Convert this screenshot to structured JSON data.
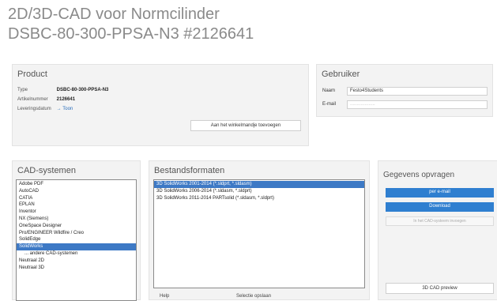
{
  "header": {
    "title_line1": "2D/3D-CAD voor Normcilinder",
    "title_line2": "DSBC-80-300-PPSA-N3 #2126641"
  },
  "product": {
    "heading": "Product",
    "type_label": "Type",
    "type_value": "DSBC-80-300-PPSA-N3",
    "article_label": "Artikelnummer",
    "article_value": "2126641",
    "delivery_label": "Leveringsdatum",
    "delivery_value": "→ Toon",
    "add_button": "Aan het winkelmandje toevoegen"
  },
  "user": {
    "heading": "Gebruiker",
    "name_label": "Naam",
    "name_value": "Festo4Students",
    "email_label": "E-mail",
    "email_placeholder": "..................."
  },
  "cad_systems": {
    "heading": "CAD-systemen",
    "items": [
      "Adobe PDF",
      "AutoCAD",
      "CATIA",
      "EPLAN",
      "Inventor",
      "NX (Siemens)",
      "OneSpace Designer",
      "Pro/ENGINEER Wildfire / Creo",
      "SolidEdge",
      "SolidWorks",
      "... andere CAD-systemen",
      "Neutraal 2D",
      "Neutraal 3D"
    ],
    "selected_index": 9
  },
  "file_formats": {
    "heading": "Bestandsformaten",
    "items": [
      "3D SolidWorks 2001-2014 (*.sldprt, *.sldasm)",
      "3D SolidWorks 2006-2014 (*.sldasm, *.sldprt)",
      "3D SolidWorks 2011-2014 PARTsolid (*.sldasm, *.sldprt)"
    ],
    "selected_index": 0,
    "help_label": "Help",
    "reset_label": "Selectie opslaan"
  },
  "request": {
    "heading": "Gegevens opvragen",
    "email_button": "per e-mail",
    "download_button": "Download",
    "add_cad_button": "In het CAD-systeem invoegen",
    "preview_button": "3D CAD preview"
  },
  "colors": {
    "accent": "#2f7fd0",
    "selection": "#3d79c5",
    "panel_bg": "#f3f3f3",
    "title_grey": "#8a8a8a"
  }
}
